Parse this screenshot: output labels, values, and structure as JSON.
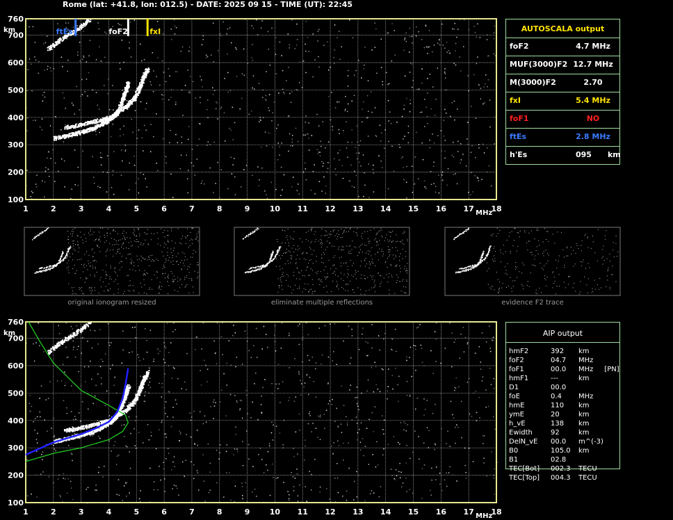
{
  "header": "Rome (lat: +41.8, lon: 012.5) - DATE: 2025 09 15 - TIME (UT): 22:45",
  "colors": {
    "frame": "#e8e890",
    "grid": "#c0c0c0",
    "table_border": "#9fdf9f",
    "ftEs": "#3a7bff",
    "fxI": "#ffe400",
    "foF1": "#ff2020",
    "aip_green": "#22cc22",
    "aip_blue": "#2020ff"
  },
  "axis": {
    "y_unit": "km",
    "x_unit": "MHz",
    "y_ticks": [
      "100",
      "200",
      "300",
      "400",
      "500",
      "600",
      "700",
      "760"
    ],
    "x_ticks": [
      "1",
      "2",
      "3",
      "4",
      "5",
      "6",
      "7",
      "8",
      "9",
      "10",
      "11",
      "12",
      "13",
      "14",
      "15",
      "16",
      "17",
      "18"
    ],
    "x_range": [
      1,
      18
    ],
    "y_range": [
      100,
      760
    ]
  },
  "top_markers": [
    {
      "label": "ftEs",
      "freq": 2.8,
      "color": "#3a7bff"
    },
    {
      "label": "foF2",
      "freq": 4.7,
      "color": "#ffffff"
    },
    {
      "label": "fxI",
      "freq": 5.4,
      "color": "#ffe400"
    }
  ],
  "autoscala": {
    "title": "AUTOSCALA output",
    "rows": [
      {
        "key": "foF2",
        "value": "4.7 MHz",
        "color": "#ffffff"
      },
      {
        "key": "MUF(3000)F2",
        "value": "12.7 MHz",
        "color": "#ffffff"
      },
      {
        "key": "M(3000)F2",
        "value": "2.70",
        "color": "#ffffff"
      },
      {
        "key": "fxI",
        "value": "5.4 MHz",
        "color": "#ffe400"
      },
      {
        "key": "foF1",
        "value": "NO",
        "color": "#ff2020"
      },
      {
        "key": "ftEs",
        "value": "2.8 MHz",
        "color": "#3a7bff"
      },
      {
        "key": "h'Es",
        "value": "095      km",
        "color": "#ffffff"
      }
    ]
  },
  "thumbnails": [
    {
      "caption": "original ionogram resized"
    },
    {
      "caption": "eliminate multiple reflections"
    },
    {
      "caption": "evidence F2 trace"
    }
  ],
  "aip": {
    "title": "AIP output",
    "rows": [
      {
        "k": "hmF2",
        "v": "392",
        "u": "km"
      },
      {
        "k": "foF2",
        "v": "04.7",
        "u": "MHz"
      },
      {
        "k": "foF1",
        "v": "00.0",
        "u": "MHz     [PN]"
      },
      {
        "k": "hmF1",
        "v": "---",
        "u": "km"
      },
      {
        "k": "D1",
        "v": "00.0",
        "u": ""
      },
      {
        "k": "foE",
        "v": "0.4",
        "u": "MHz"
      },
      {
        "k": "hmE",
        "v": "110",
        "u": "km"
      },
      {
        "k": "ymE",
        "v": "20",
        "u": "km"
      },
      {
        "k": "h_vE",
        "v": "138",
        "u": "km"
      },
      {
        "k": "Ewidth",
        "v": "92",
        "u": "km"
      },
      {
        "k": "DelN_vE",
        "v": "00.0",
        "u": "m^(-3)"
      },
      {
        "k": "B0",
        "v": "105.0",
        "u": "km"
      },
      {
        "k": "B1",
        "v": "02.8",
        "u": ""
      },
      {
        "k": "TEC[Bot]",
        "v": "002.3",
        "u": "TECU"
      },
      {
        "k": "TEC[Top]",
        "v": "004.3",
        "u": "TECU"
      }
    ]
  },
  "chart_data": [
    {
      "type": "scatter",
      "xlabel": "MHz",
      "ylabel": "km",
      "xlim": [
        1,
        18
      ],
      "ylim": [
        100,
        760
      ],
      "series": [
        {
          "name": "",
          "points": [
            [
              2.0,
              325
            ],
            [
              2.5,
              335
            ],
            [
              3.0,
              348
            ],
            [
              3.4,
              360
            ],
            [
              3.8,
              380
            ],
            [
              4.1,
              400
            ],
            [
              4.35,
              430
            ],
            [
              4.5,
              470
            ],
            [
              4.6,
              500
            ],
            [
              4.7,
              530
            ]
          ]
        },
        {
          "name": "",
          "points": [
            [
              2.4,
              365
            ],
            [
              3.0,
              375
            ],
            [
              3.6,
              390
            ],
            [
              4.1,
              405
            ],
            [
              4.6,
              440
            ],
            [
              4.9,
              470
            ],
            [
              5.1,
              510
            ],
            [
              5.25,
              550
            ],
            [
              5.4,
              580
            ]
          ]
        },
        {
          "name": "",
          "points": [
            [
              1.8,
              650
            ],
            [
              2.3,
              690
            ],
            [
              2.8,
              720
            ],
            [
              3.3,
              760
            ]
          ]
        }
      ]
    },
    {
      "type": "line",
      "xlabel": "MHz",
      "ylabel": "km",
      "xlim": [
        1,
        18
      ],
      "ylim": [
        100,
        760
      ],
      "series": [
        {
          "name": "",
          "color": "#22cc22",
          "points": [
            [
              1.0,
              250
            ],
            [
              2.0,
              280
            ],
            [
              3.0,
              300
            ],
            [
              4.0,
              330
            ],
            [
              4.5,
              360
            ],
            [
              4.7,
              392
            ],
            [
              4.6,
              420
            ],
            [
              4.0,
              455
            ],
            [
              3.0,
              510
            ],
            [
              2.0,
              610
            ],
            [
              1.5,
              690
            ],
            [
              1.1,
              760
            ]
          ]
        },
        {
          "name": "",
          "color": "#2020ff",
          "points": [
            [
              1.0,
              275
            ],
            [
              2.0,
              320
            ],
            [
              3.0,
              350
            ],
            [
              3.5,
              370
            ],
            [
              4.0,
              395
            ],
            [
              4.3,
              430
            ],
            [
              4.5,
              480
            ],
            [
              4.6,
              530
            ],
            [
              4.7,
              590
            ]
          ]
        }
      ]
    }
  ]
}
